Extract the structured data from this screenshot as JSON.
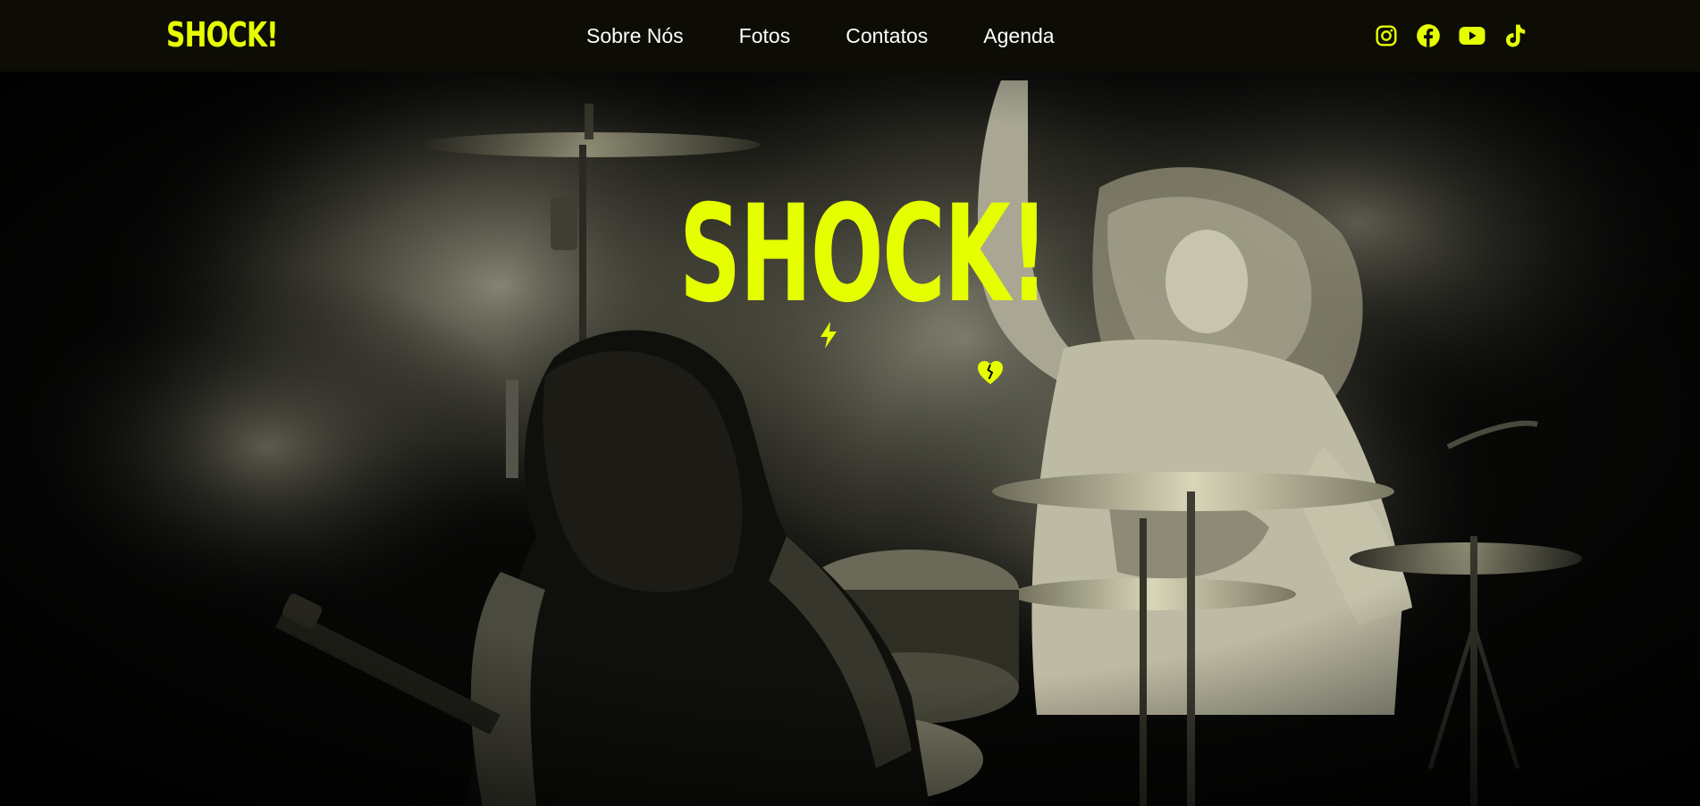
{
  "brand": {
    "name": "SHOCK!",
    "accent_color": "#e6ff00",
    "nav_bg_color": "#0d0d05"
  },
  "nav": {
    "links": [
      {
        "label": "Sobre Nós"
      },
      {
        "label": "Fotos"
      },
      {
        "label": "Contatos"
      },
      {
        "label": "Agenda"
      }
    ],
    "social": [
      {
        "icon": "instagram-icon"
      },
      {
        "icon": "facebook-icon"
      },
      {
        "icon": "youtube-icon"
      },
      {
        "icon": "tiktok-icon"
      }
    ]
  },
  "hero": {
    "logo_text": "SHOCK!",
    "image": "black-and-white concert photo: drummer headbanging behind drum kit and cymbals, long-haired guitarist seen from behind"
  }
}
